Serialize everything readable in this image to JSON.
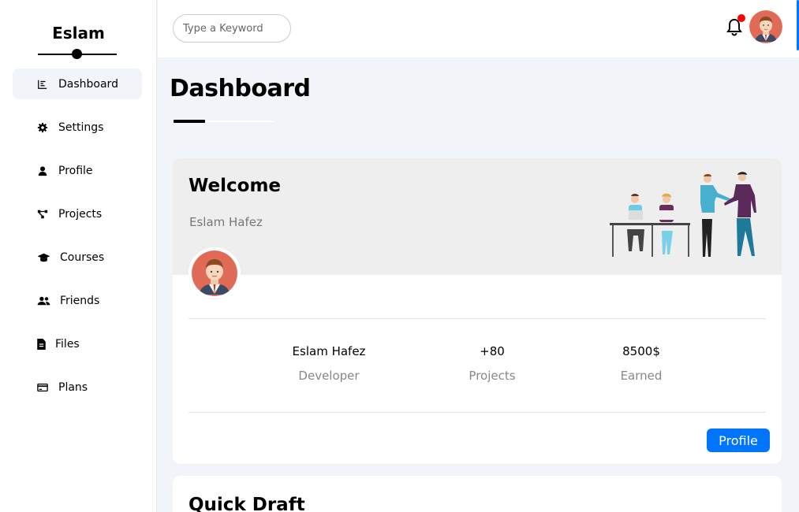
{
  "brand": {
    "name": "Eslam"
  },
  "sidebar": {
    "items": [
      {
        "label": "Dashboard",
        "icon": "chart-icon",
        "active": true
      },
      {
        "label": "Settings",
        "icon": "gear-icon",
        "active": false
      },
      {
        "label": "Profile",
        "icon": "user-icon",
        "active": false
      },
      {
        "label": "Projects",
        "icon": "diagram-icon",
        "active": false
      },
      {
        "label": "Courses",
        "icon": "graduation-cap-icon",
        "active": false
      },
      {
        "label": "Friends",
        "icon": "users-icon",
        "active": false
      },
      {
        "label": "Files",
        "icon": "file-icon",
        "active": false
      },
      {
        "label": "Plans",
        "icon": "credit-card-icon",
        "active": false
      }
    ]
  },
  "header": {
    "search_placeholder": "Type a Keyword",
    "notification_icon": "bell-icon",
    "has_notification": true
  },
  "page": {
    "title": "Dashboard"
  },
  "welcome": {
    "title": "Welcome",
    "name": "Eslam Hafez",
    "stats": [
      {
        "value": "Eslam Hafez",
        "label": "Developer"
      },
      {
        "value": "+80",
        "label": "Projects"
      },
      {
        "value": "8500$",
        "label": "Earned"
      }
    ],
    "button_label": "Profile"
  },
  "quick_draft": {
    "title": "Quick Draft"
  },
  "colors": {
    "accent": "#0075ff",
    "notification": "#ff0000",
    "background": "#f1f5f9"
  }
}
